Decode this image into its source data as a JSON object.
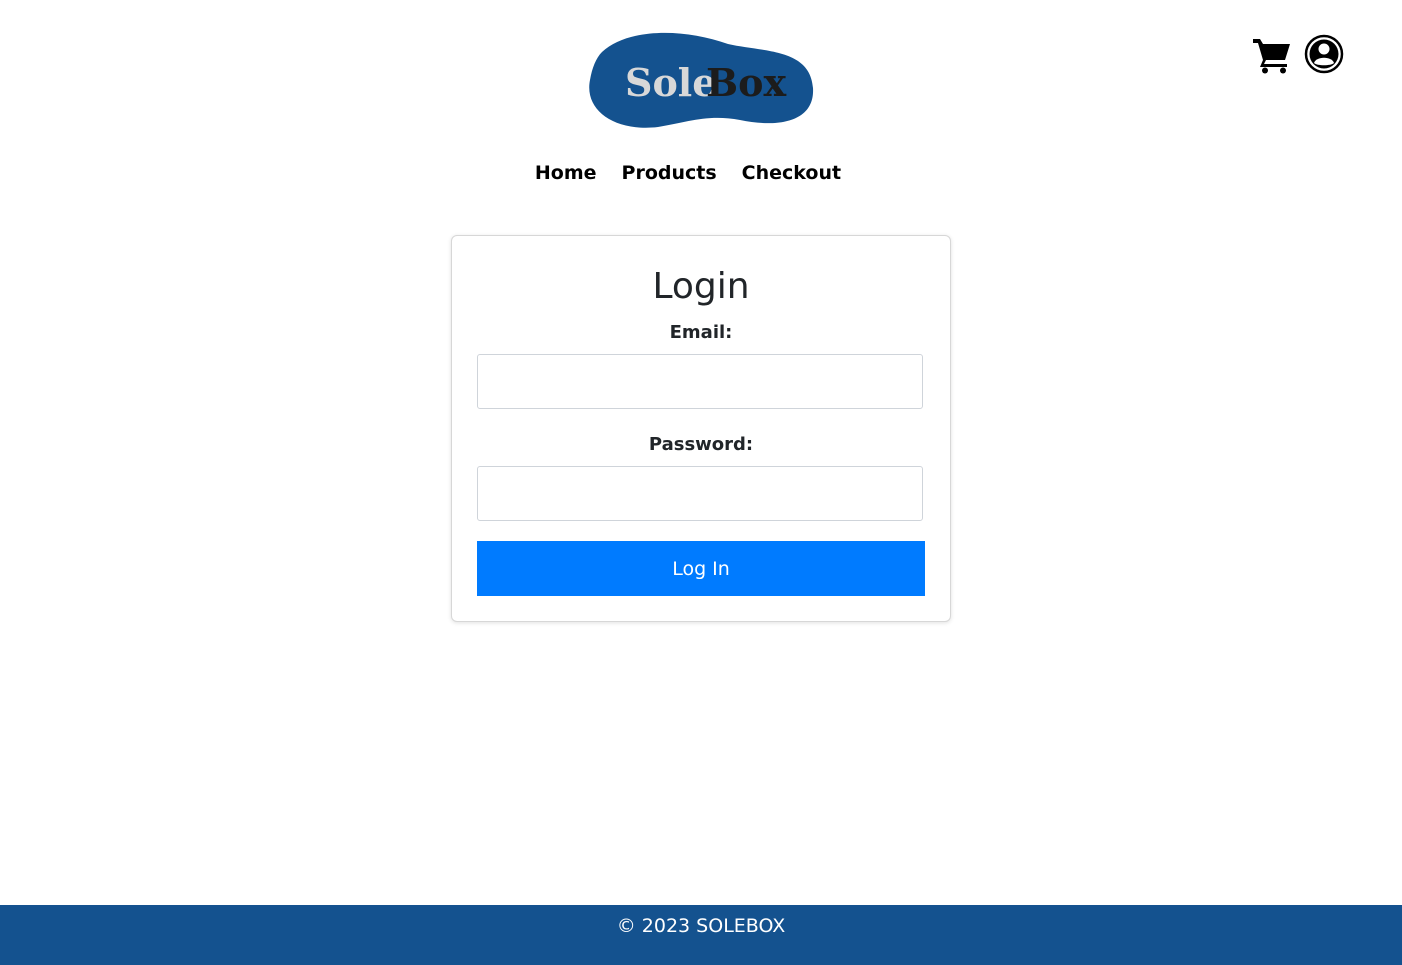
{
  "brand": {
    "logo_part1": "Sole",
    "logo_part2": "Box",
    "logo_bg_color": "#14528f",
    "logo_text1_color": "#d8d8d8",
    "logo_text2_color": "#1c1c1c"
  },
  "header": {
    "icons": [
      "cart-icon",
      "user-account-icon"
    ]
  },
  "nav": {
    "items": [
      {
        "label": "Home"
      },
      {
        "label": "Products"
      },
      {
        "label": "Checkout"
      }
    ]
  },
  "login": {
    "title": "Login",
    "email_label": "Email:",
    "email_value": "",
    "password_label": "Password:",
    "password_value": "",
    "submit_label": "Log In",
    "button_color": "#007bff"
  },
  "footer": {
    "text": "© 2023 SOLEBOX",
    "bg_color": "#14528f"
  }
}
